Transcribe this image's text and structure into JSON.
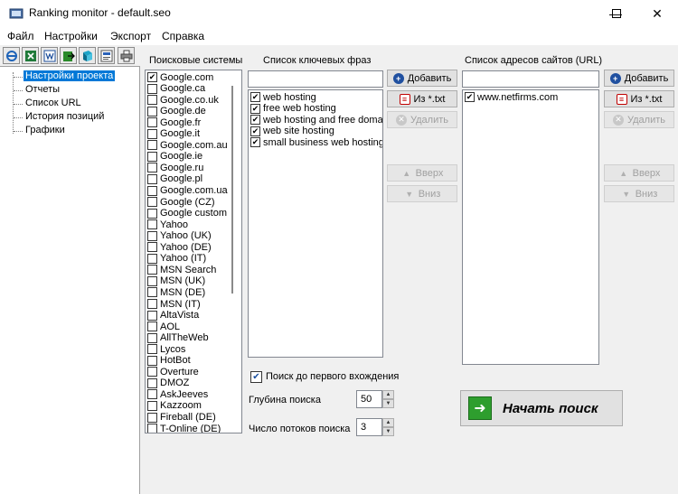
{
  "window": {
    "title": "Ranking monitor - default.seo",
    "icon": "app-icon",
    "minimize": "—",
    "maximize": "☐",
    "close": "✕"
  },
  "menu": [
    {
      "label": "Файл"
    },
    {
      "label": "Настройки"
    },
    {
      "label": "Экспорт"
    },
    {
      "label": "Справка"
    }
  ],
  "toolbar": [
    {
      "icon": "ie-icon"
    },
    {
      "icon": "excel-icon"
    },
    {
      "icon": "word-icon"
    },
    {
      "icon": "export-icon"
    },
    {
      "icon": "book-icon"
    },
    {
      "icon": "html-icon"
    },
    {
      "icon": "printer-icon"
    }
  ],
  "tree": {
    "items": [
      {
        "label": "Настройки проекта",
        "selected": true
      },
      {
        "label": "Отчеты"
      },
      {
        "label": "Список URL"
      },
      {
        "label": "История позиций"
      },
      {
        "label": "Графики"
      }
    ],
    "selected_color": "#0078d7"
  },
  "engines": {
    "label": "Поисковые системы",
    "items": [
      {
        "label": "Google.com",
        "checked": true
      },
      {
        "label": "Google.ca",
        "checked": false
      },
      {
        "label": "Google.co.uk",
        "checked": false
      },
      {
        "label": "Google.de",
        "checked": false
      },
      {
        "label": "Google.fr",
        "checked": false
      },
      {
        "label": "Google.it",
        "checked": false
      },
      {
        "label": "Google.com.au",
        "checked": false
      },
      {
        "label": "Google.ie",
        "checked": false
      },
      {
        "label": "Google.ru",
        "checked": false
      },
      {
        "label": "Google.pl",
        "checked": false
      },
      {
        "label": "Google.com.ua",
        "checked": false
      },
      {
        "label": "Google (CZ)",
        "checked": false
      },
      {
        "label": "Google custom",
        "checked": false
      },
      {
        "label": "Yahoo",
        "checked": false
      },
      {
        "label": "Yahoo (UK)",
        "checked": false
      },
      {
        "label": "Yahoo (DE)",
        "checked": false
      },
      {
        "label": "Yahoo (IT)",
        "checked": false
      },
      {
        "label": "MSN Search",
        "checked": false
      },
      {
        "label": "MSN (UK)",
        "checked": false
      },
      {
        "label": "MSN (DE)",
        "checked": false
      },
      {
        "label": "MSN (IT)",
        "checked": false
      },
      {
        "label": "AltaVista",
        "checked": false
      },
      {
        "label": "AOL",
        "checked": false
      },
      {
        "label": "AllTheWeb",
        "checked": false
      },
      {
        "label": "Lycos",
        "checked": false
      },
      {
        "label": "HotBot",
        "checked": false
      },
      {
        "label": "Overture",
        "checked": false
      },
      {
        "label": "DMOZ",
        "checked": false
      },
      {
        "label": "AskJeeves",
        "checked": false
      },
      {
        "label": "Kazzoom",
        "checked": false
      },
      {
        "label": "Fireball (DE)",
        "checked": false
      },
      {
        "label": "T-Online (DE)",
        "checked": false
      }
    ]
  },
  "keywords": {
    "label": "Список ключевых фраз",
    "input_value": "",
    "items": [
      {
        "label": "web hosting",
        "checked": true
      },
      {
        "label": "free web hosting",
        "checked": true
      },
      {
        "label": "web hosting and free domain",
        "checked": true
      },
      {
        "label": "web site hosting",
        "checked": true
      },
      {
        "label": "small business web hosting",
        "checked": true
      }
    ],
    "buttons": {
      "add": "Добавить",
      "import": "Из *.txt",
      "delete": "Удалить",
      "up": "Вверх",
      "down": "Вниз"
    }
  },
  "urls": {
    "label": "Список адресов сайтов (URL)",
    "input_value": "",
    "items": [
      {
        "label": "www.netfirms.com",
        "checked": true
      }
    ],
    "buttons": {
      "add": "Добавить",
      "import": "Из *.txt",
      "delete": "Удалить",
      "up": "Вверх",
      "down": "Вниз"
    }
  },
  "options": {
    "first_match_label": "Поиск до первого вхождения",
    "first_match_checked": true,
    "depth_label": "Глубина поиска",
    "depth_value": "50",
    "threads_label": "Число потоков поиска",
    "threads_value": "3"
  },
  "start_button": {
    "label": "Начать поиск",
    "icon": "arrow-right-icon"
  }
}
